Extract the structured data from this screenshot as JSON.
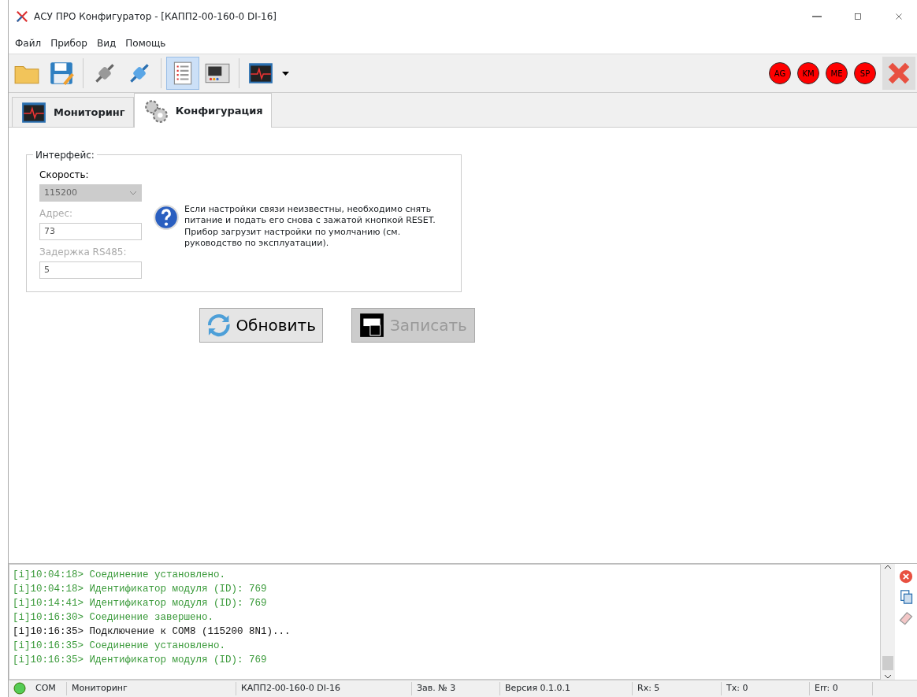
{
  "window": {
    "title": "АСУ ПРО Конфигуратор - [КАПП2-00-160-0 DI-16]"
  },
  "menu": [
    "Файл",
    "Прибор",
    "Вид",
    "Помощь"
  ],
  "toolbar": [
    {
      "kind": "folder",
      "selected": false
    },
    {
      "kind": "save",
      "selected": false
    },
    {
      "kind": "plug-off",
      "selected": false
    },
    {
      "kind": "plug-on",
      "selected": false
    },
    {
      "kind": "report",
      "selected": true
    },
    {
      "kind": "device",
      "selected": false
    },
    {
      "kind": "monitor",
      "selected": false
    }
  ],
  "indicators": [
    {
      "label": "AG",
      "on": true
    },
    {
      "label": "KM",
      "on": true
    },
    {
      "label": "ME",
      "on": true
    },
    {
      "label": "SP",
      "on": true
    }
  ],
  "tabs": [
    {
      "label": "Мониторинг",
      "kind": "monitor",
      "selected": false
    },
    {
      "label": "Конфигурация",
      "kind": "gears",
      "selected": true
    }
  ],
  "interface": {
    "legend": "Интерфейс:",
    "fields": [
      {
        "label": "Скорость:",
        "kind": "select",
        "value": "115200",
        "label_dimmed": false,
        "disabled": true
      },
      {
        "label": "Адрес:",
        "kind": "input",
        "value": "73",
        "label_dimmed": true,
        "disabled": true
      },
      {
        "label": "Задержка RS485:",
        "kind": "input",
        "value": "5",
        "label_dimmed": true,
        "disabled": true
      }
    ],
    "hint": "Если настройки связи неизвестны, необходимо снять питание и подать его снова с зажатой кнопкой RESET. Прибор загрузит настройки по умолчанию (см. руководство по эксплуатации)."
  },
  "buttons": [
    {
      "label": "Обновить",
      "kind": "refresh",
      "disabled": false
    },
    {
      "label": "Записать",
      "kind": "write",
      "disabled": true
    }
  ],
  "log": [
    {
      "text": "[i]10:04:18> Соединение установлено.",
      "kind": "ok"
    },
    {
      "text": "[i]10:04:18> Идентификатор модуля (ID): 769",
      "kind": "ok"
    },
    {
      "text": "[i]10:14:41> Идентификатор модуля (ID): 769",
      "kind": "ok"
    },
    {
      "text": "[i]10:16:30> Соединение завершено.",
      "kind": "ok"
    },
    {
      "text": "[i]10:16:35> Подключение к COM8 (115200 8N1)...",
      "kind": "plain"
    },
    {
      "text": "[i]10:16:35> Соединение установлено.",
      "kind": "ok"
    },
    {
      "text": "[i]10:16:35> Идентификатор модуля (ID): 769",
      "kind": "ok"
    }
  ],
  "status_bar": {
    "connected": true,
    "cells": [
      "COM",
      "Мониторинг",
      "КАПП2-00-160-0 DI-16",
      "Зав. № 3",
      "Версия 0.1.0.1",
      "Rx: 5",
      "Tx: 0",
      "Err: 0"
    ]
  }
}
